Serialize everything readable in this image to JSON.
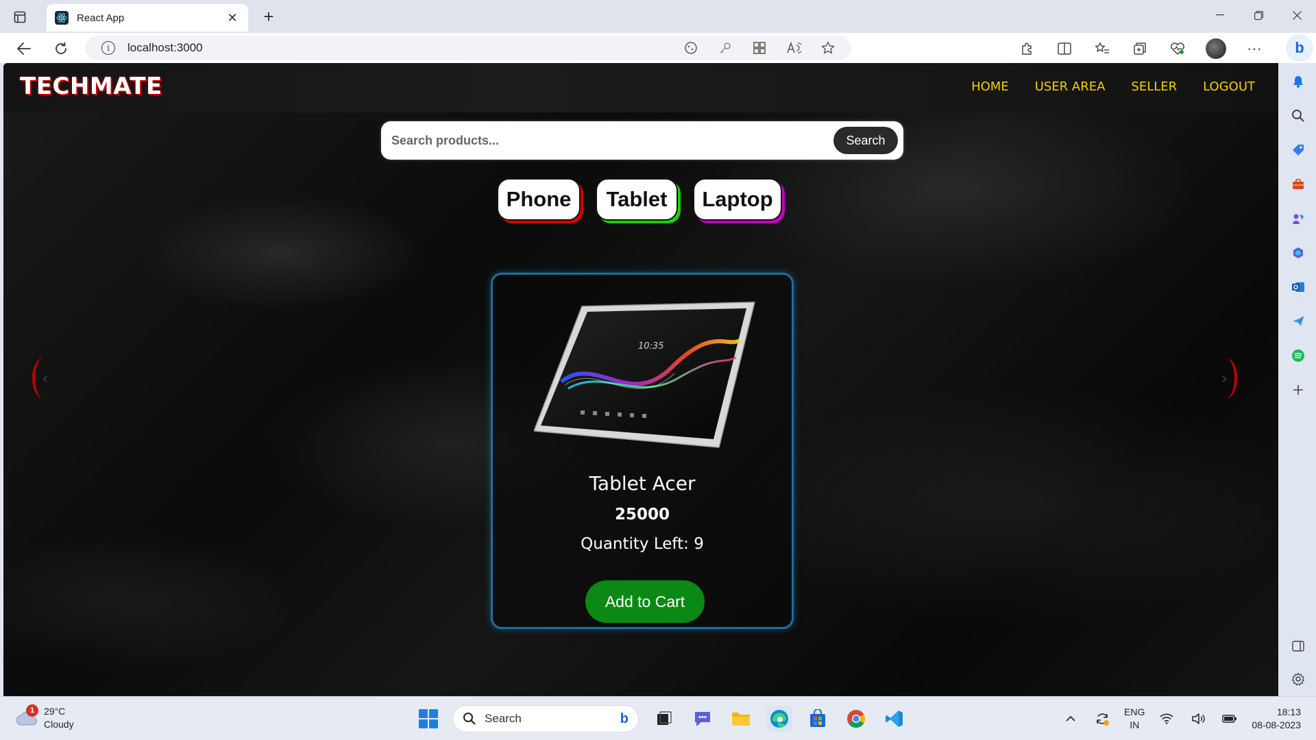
{
  "browser": {
    "tab_title": "React App",
    "url": "localhost:3000",
    "new_tab_symbol": "+",
    "close_symbol": "✕"
  },
  "site": {
    "logo": "TECHMATE",
    "nav": [
      "HOME",
      "USER AREA",
      "SELLER",
      "LOGOUT"
    ],
    "search": {
      "placeholder": "Search products...",
      "button": "Search"
    },
    "categories": [
      "Phone",
      "Tablet",
      "Laptop"
    ],
    "carousel": {
      "prev": "‹",
      "next": "›"
    },
    "product": {
      "name": "Tablet Acer",
      "price": "25000",
      "quantity_label": "Quantity Left: ",
      "quantity": "9",
      "add_to_cart": "Add to Cart",
      "image_clock": "10:35"
    }
  },
  "taskbar": {
    "weather": {
      "temp": "29°C",
      "condition": "Cloudy",
      "badge": "1"
    },
    "search_label": "Search",
    "language": {
      "line1": "ENG",
      "line2": "IN"
    },
    "time": "18:13",
    "date": "08-08-2023"
  },
  "colors": {
    "nav_link": "#f5d000",
    "card_border": "#1e6ea0",
    "add_to_cart": "#0a8a14",
    "phone_shadow": "#d40000",
    "tablet_shadow": "#1bd000",
    "laptop_shadow": "#c000c0"
  }
}
